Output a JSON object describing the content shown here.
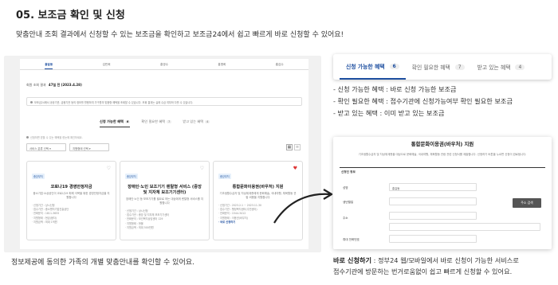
{
  "header": {
    "title": "05. 보조금 확인 및 신청",
    "subtitle": "맞춤안내 조회 결과에서 신청할 수 있는 보조금을 확인하고 보조금24에서 쉽고 빠르게 바로 신청할 수 있어요!"
  },
  "screenshot": {
    "person_tabs": [
      "홍길동",
      "김민희",
      "홍영수",
      "홍명희",
      "홍갑수"
    ],
    "result_meta": "회원 조회 결과",
    "result_count": "47일 전 (2023.4.28)",
    "notice": "보조금24에서 공공기관, 금융기관 등의 정보를 활용하여 가구원의 맞춤형 혜택을 조회할 수 있습니다. 조회 결과는 실제 수급 여부와 다를 수 있습니다.",
    "category_tabs": [
      {
        "label": "신청 가능한 혜택",
        "count": "6"
      },
      {
        "label": "확인 필요한 혜택",
        "count": "7"
      },
      {
        "label": "받고 있는 혜택",
        "count": "4"
      }
    ],
    "filter_note": "신청하면 받을 수 있는 혜택을 한눈에 확인하세요.",
    "filter_selects": [
      "서비스 분류 선택",
      "지원형태 선택"
    ],
    "cards": [
      {
        "agency": "중앙부처",
        "title": "코로나19 경영안정자금",
        "desc": "중소기업·소상공인이 코로나19 피해 극복을 위한 경영안정자금을 지원합니다",
        "meta": [
          "· 신청기간 : 상시신청",
          "· 접수기관 : 중소벤처기업진흥공단",
          "· 전화문의 : 1811-3655",
          "· 지원형태 : 현금(융자)",
          "· 지원금액 : 최대 1억원"
        ],
        "heart": "gray"
      },
      {
        "agency": "중앙부처",
        "title": "장애인·노인 보조기기 렌탈형 서비스 (중앙 및 지자체 보조기기센터)",
        "desc": "장애인·노인 등 보조기기를 필요로 하는 대상에게 렌탈형 서비스를 지원합니다",
        "meta": [
          "· 신청기간 : 상시신청",
          "· 접수기관 : 중앙 및 지자체 보조기기센터",
          "· 전화문의 : 보건복지상담센터 129",
          "· 지원형태 : 현물",
          "· 지원금액 : 최대 500만원"
        ],
        "heart": "gray"
      },
      {
        "agency": "중앙부처",
        "title": "통합문화이용권(바우처) 지원",
        "desc": "기초생활수급자 및 차상위계층에게 문화예술, 국내여행, 체육활동 관람 비용을 지원합니다",
        "meta": [
          "· 신청기간 : 2023.2.1 ~ 2023.11.30",
          "· 접수기관 : 행정복지센터(주민센터)",
          "· 전화문의 : 1544-3412",
          "· 지원형태 : 이용권(바우처)",
          "· 바로 신청하기"
        ],
        "heart": "red"
      }
    ]
  },
  "caption": "정보제공에 동의한 가족의 개별 맞춤안내를 확인할 수 있어요.",
  "callout_tabs": [
    {
      "label": "신청 가능한 혜택",
      "count": "6"
    },
    {
      "label": "확인 필요한 혜택",
      "count": "7"
    },
    {
      "label": "받고 있는 혜택",
      "count": "4"
    }
  ],
  "bullets": [
    "- 신청 가능한 혜택 : 바로 신청 가능한 보조금",
    "- 확인 필요한 혜택 : 접수기관에 신청가능여부 확인 필요한 보조금",
    "- 받고 있는 혜택 : 이미 받고 있는 보조금"
  ],
  "detail": {
    "title": "통합문화이용권(바우처) 지원",
    "note": "기초생활수급자 및 차상위계층을 대상으로 문화예술, 국내여행, 체육활동 관람 관련 신청서를 제출합니다. 신청하기 버튼을 누르면 신청이 완료됩니다.",
    "section": "신청인 정보",
    "fields": [
      {
        "label": "성명",
        "value": "홍길동"
      },
      {
        "label": "생년월일",
        "value": ""
      },
      {
        "label": "주소",
        "value": ""
      },
      {
        "label": "",
        "value": ""
      },
      {
        "label": "휴대 전화번호",
        "value": ""
      }
    ],
    "button": "주소 검색"
  },
  "bottom": {
    "bold": "바로 신청하기",
    "line1": " : 정부24 웹/모바일에서 바로 신청이 가능한 서비스로",
    "line2": "접수기관에 방문하는 번거로움없이 쉽고 빠르게 신청할 수 있어요."
  }
}
